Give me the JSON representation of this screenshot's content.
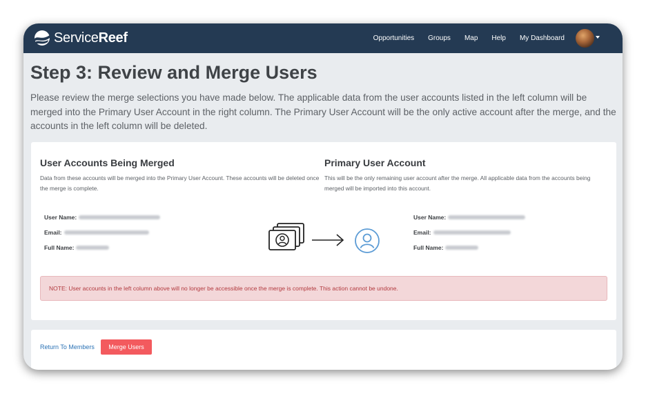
{
  "app": {
    "logo_name_light": "Service",
    "logo_name_bold": "Reef"
  },
  "navbar": {
    "links": [
      "Opportunities",
      "Groups",
      "Map",
      "Help",
      "My Dashboard"
    ]
  },
  "page": {
    "title": "Step 3: Review and Merge Users",
    "intro": "Please review the merge selections you have made below. The applicable data from the user accounts listed in the left column will be merged into the Primary User Account in the right column. The Primary User Account will be the only active account after the merge, and the accounts in the left column will be deleted."
  },
  "merged_accounts": {
    "title": "User Accounts Being Merged",
    "description": "Data from these accounts will be merged into the Primary User Account. These accounts will be deleted once the merge is complete.",
    "fields": [
      {
        "label": "User Name:"
      },
      {
        "label": "Email:"
      },
      {
        "label": "Full Name:"
      }
    ]
  },
  "primary_account": {
    "title": "Primary User Account",
    "description": "This will be the only remaining user account after the merge. All applicable data from the accounts being merged will be imported into this account.",
    "fields": [
      {
        "label": "User Name:"
      },
      {
        "label": "Email:"
      },
      {
        "label": "Full Name:"
      }
    ]
  },
  "icons": {
    "merged": "stacked-accounts-icon",
    "arrow": "arrow-right-icon",
    "primary": "user-circle-icon",
    "accent": "#5b9bd5"
  },
  "note": "NOTE: User accounts in the left column above will no longer be accessible once the merge is complete. This action cannot be undone.",
  "actions": {
    "return_label": "Return To Members",
    "merge_label": "Merge Users"
  },
  "colors": {
    "navbar": "#243a53",
    "link": "#2a72b5",
    "danger": "#f35a5e",
    "note_bg": "#f3d7d9",
    "note_text": "#b23a3f"
  }
}
